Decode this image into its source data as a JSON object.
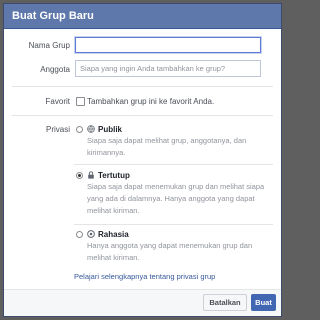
{
  "dialog": {
    "title": "Buat Grup Baru"
  },
  "form": {
    "name_label": "Nama Grup",
    "name_value": "",
    "members_label": "Anggota",
    "members_placeholder": "Siapa yang ingin Anda tambahkan ke grup?",
    "favorite_label": "Favorit",
    "favorite_checkbox_text": "Tambahkan grup ini ke favorit Anda.",
    "favorite_checked": false
  },
  "privacy": {
    "label": "Privasi",
    "options": [
      {
        "title": "Publik",
        "icon": "globe-icon",
        "description": "Siapa saja dapat melihat grup, anggotanya, dan kirimannya.",
        "selected": false
      },
      {
        "title": "Tertutup",
        "icon": "lock-icon",
        "description": "Siapa saja dapat menemukan grup dan melihat siapa yang ada di dalamnya. Hanya anggota yang dapat melihat kiriman.",
        "selected": true
      },
      {
        "title": "Rahasia",
        "icon": "secret-icon",
        "description": "Hanya anggota yang dapat menemukan grup dan melihat kiriman.",
        "selected": false
      }
    ],
    "learn_more_link": "Pelajari selengkapnya tentang privasi grup"
  },
  "footer": {
    "cancel_label": "Batalkan",
    "create_label": "Buat"
  },
  "colors": {
    "titlebar": "#5f78ab",
    "primary_button": "#4267b2",
    "link": "#365899"
  }
}
